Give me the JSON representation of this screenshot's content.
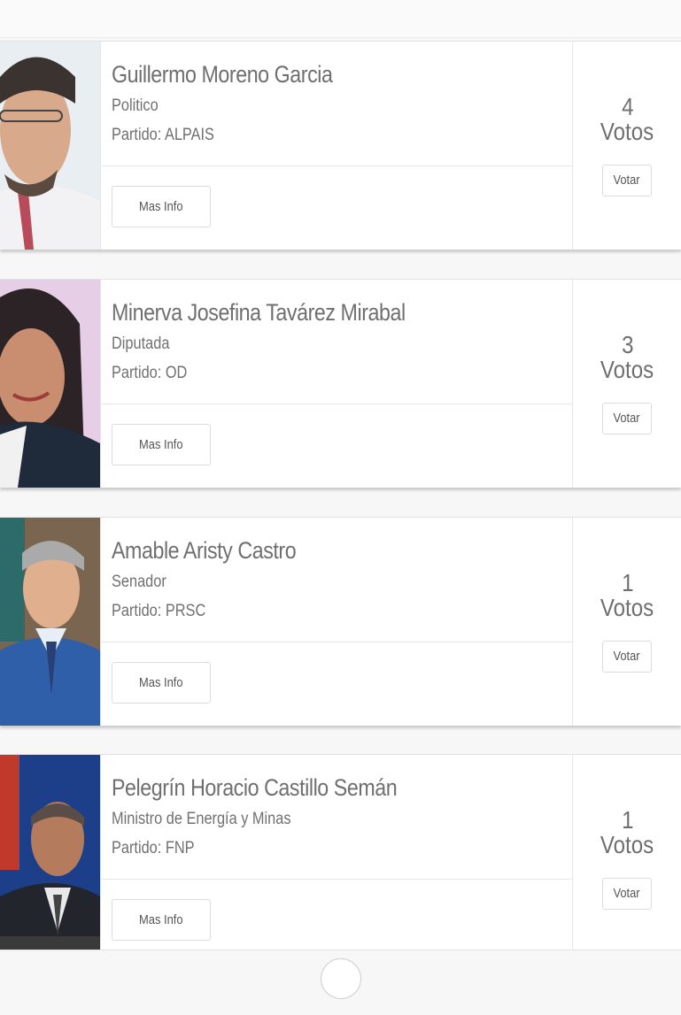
{
  "candidates": [
    {
      "name": "Guillermo Moreno Garcia",
      "role": "Politico",
      "party": "Partido: ALPAIS",
      "votes": "4",
      "votes_unit": "Votos",
      "vote_label": "Votar",
      "more_label": "Mas Info"
    },
    {
      "name": "Minerva Josefina Tavárez Mirabal",
      "role": "Diputada",
      "party": "Partido: OD",
      "votes": "3",
      "votes_unit": "Votos",
      "vote_label": "Votar",
      "more_label": "Mas Info"
    },
    {
      "name": "Amable Aristy Castro",
      "role": "Senador",
      "party": "Partido: PRSC",
      "votes": "1",
      "votes_unit": "Votos",
      "vote_label": "Votar",
      "more_label": "Mas Info"
    },
    {
      "name": "Pelegrín Horacio Castillo Semán",
      "role": "Ministro de Energía y Minas",
      "party": "Partido: FNP",
      "votes": "1",
      "votes_unit": "Votos",
      "vote_label": "Votar",
      "more_label": "Mas Info"
    }
  ]
}
